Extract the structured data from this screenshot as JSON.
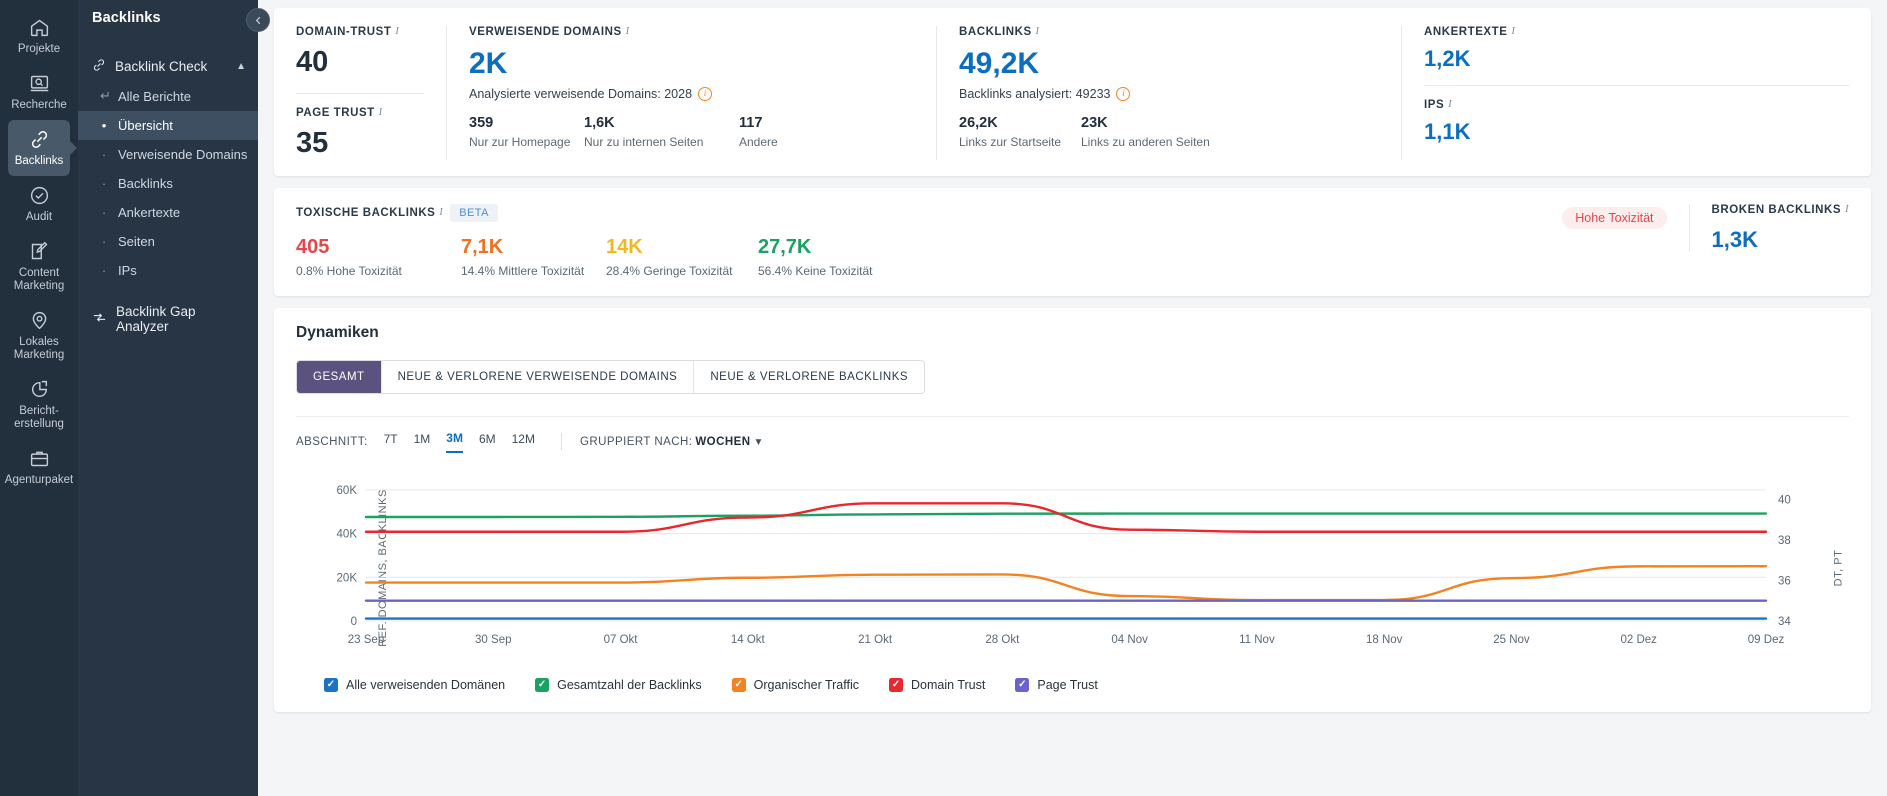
{
  "rail": {
    "items": [
      {
        "label": "Projekte",
        "icon": "home-icon",
        "active": false
      },
      {
        "label": "Recherche",
        "icon": "research-icon",
        "active": false
      },
      {
        "label": "Backlinks",
        "icon": "link-icon",
        "active": true
      },
      {
        "label": "Audit",
        "icon": "check-circle-icon",
        "active": false
      },
      {
        "label": "Content\nMarketing",
        "icon": "edit-square-icon",
        "active": false
      },
      {
        "label": "Lokales\nMarketing",
        "icon": "map-pin-icon",
        "active": false
      },
      {
        "label": "Bericht-\nerstellung",
        "icon": "pie-chart-icon",
        "active": false
      },
      {
        "label": "Agenturpaket",
        "icon": "briefcase-icon",
        "active": false
      }
    ]
  },
  "subnav": {
    "title": "Backlinks",
    "group_label": "Backlink Check",
    "items": [
      {
        "label": "Alle Berichte",
        "marker": "arrow"
      },
      {
        "label": "Übersicht",
        "marker": "dot",
        "selected": true
      },
      {
        "label": "Verweisende Domains",
        "marker": "dash"
      },
      {
        "label": "Backlinks",
        "marker": "dash"
      },
      {
        "label": "Ankertexte",
        "marker": "dash"
      },
      {
        "label": "Seiten",
        "marker": "dash"
      },
      {
        "label": "IPs",
        "marker": "dash"
      }
    ],
    "gap_analyzer": "Backlink Gap Analyzer"
  },
  "kpi": {
    "domain_trust": {
      "label": "DOMAIN-TRUST",
      "value": "40"
    },
    "page_trust": {
      "label": "PAGE TRUST",
      "value": "35"
    },
    "referring_domains": {
      "label": "VERWEISENDE DOMAINS",
      "value": "2K",
      "sub": "Analysierte verweisende Domains: 2028",
      "splits": [
        {
          "value": "359",
          "text": "Nur zur Homepage"
        },
        {
          "value": "1,6K",
          "text": "Nur zu internen Seiten"
        },
        {
          "value": "117",
          "text": "Andere"
        }
      ]
    },
    "backlinks": {
      "label": "BACKLINKS",
      "value": "49,2K",
      "sub": "Backlinks analysiert: 49233",
      "splits": [
        {
          "value": "26,2K",
          "text": "Links zur Startseite"
        },
        {
          "value": "23K",
          "text": "Links zu anderen Seiten"
        }
      ]
    },
    "anchor_texts": {
      "label": "ANKERTEXTE",
      "value": "1,2K"
    },
    "ips": {
      "label": "IPS",
      "value": "1,1K"
    }
  },
  "toxic": {
    "label": "TOXISCHE BACKLINKS",
    "badge": "BETA",
    "items": [
      {
        "value": "405",
        "text": "0.8% Hohe Toxizität",
        "color": "#e8464a"
      },
      {
        "value": "7,1K",
        "text": "14.4% Mittlere Toxizität",
        "color": "#f27021"
      },
      {
        "value": "14K",
        "text": "28.4% Geringe Toxizität",
        "color": "#f0b823"
      },
      {
        "value": "27,7K",
        "text": "56.4% Keine Toxizität",
        "color": "#1aa260"
      }
    ],
    "pill": "Hohe Toxizität",
    "broken": {
      "label": "BROKEN BACKLINKS",
      "value": "1,3K"
    }
  },
  "dynamics": {
    "title": "Dynamiken",
    "tabs": [
      {
        "label": "GESAMT",
        "active": true
      },
      {
        "label": "NEUE & VERLORENE VERWEISENDE DOMAINS",
        "active": false
      },
      {
        "label": "NEUE & VERLORENE BACKLINKS",
        "active": false
      }
    ],
    "period_label": "ABSCHNITT:",
    "periods": [
      {
        "label": "7T",
        "active": false
      },
      {
        "label": "1M",
        "active": false
      },
      {
        "label": "3M",
        "active": true
      },
      {
        "label": "6M",
        "active": false
      },
      {
        "label": "12M",
        "active": false
      }
    ],
    "grouped_label": "GRUPPIERT NACH:",
    "grouped_value": "WOCHEN"
  },
  "chart_data": {
    "type": "line",
    "title": "Dynamiken",
    "ylabel": "REF. DOMAINS, BACKLINKS",
    "ylabel_right": "DT, PT",
    "grid": true,
    "legend_position": "bottom",
    "ylim": [
      0,
      65000
    ],
    "yticks": [
      "0",
      "20K",
      "40K",
      "60K"
    ],
    "ytick_values": [
      0,
      20000,
      40000,
      60000
    ],
    "ylim_right": [
      34,
      41
    ],
    "yticks_right": [
      "34",
      "36",
      "38",
      "40"
    ],
    "ytick_values_right": [
      34,
      36,
      38,
      40
    ],
    "x": [
      "23 Sep",
      "30 Sep",
      "07 Okt",
      "14 Okt",
      "21 Okt",
      "28 Okt",
      "04 Nov",
      "11 Nov",
      "18 Nov",
      "25 Nov",
      "02 Dez",
      "09 Dez"
    ],
    "series": [
      {
        "name": "Alle verweisenden Domänen",
        "color": "#1a73c4",
        "axis": "left",
        "values": [
          1100,
          1100,
          1100,
          1100,
          1100,
          1100,
          1100,
          1100,
          1100,
          1100,
          1100,
          1100
        ]
      },
      {
        "name": "Gesamtzahl der Backlinks",
        "color": "#1aa260",
        "axis": "left",
        "values": [
          47600,
          47600,
          47700,
          48200,
          48800,
          49100,
          49200,
          49200,
          49200,
          49200,
          49200,
          49200
        ]
      },
      {
        "name": "Organischer Traffic",
        "color": "#f58220",
        "axis": "left",
        "values": [
          17600,
          17600,
          17600,
          19800,
          21200,
          21300,
          11400,
          9600,
          9600,
          19600,
          25000,
          25100
        ]
      },
      {
        "name": "Domain Trust",
        "color": "#e8282d",
        "axis": "right",
        "values": [
          38.4,
          38.4,
          38.4,
          39.1,
          39.8,
          39.8,
          38.5,
          38.4,
          38.4,
          38.4,
          38.4,
          38.4
        ]
      },
      {
        "name": "Page Trust",
        "color": "#6b63c9",
        "axis": "left",
        "values": [
          9300,
          9300,
          9300,
          9300,
          9300,
          9300,
          9300,
          9300,
          9300,
          9300,
          9300,
          9300
        ]
      }
    ],
    "legend": [
      {
        "label": "Alle verweisenden Domänen",
        "color": "#1a73c4"
      },
      {
        "label": "Gesamtzahl der Backlinks",
        "color": "#1aa260"
      },
      {
        "label": "Organischer Traffic",
        "color": "#f58220"
      },
      {
        "label": "Domain Trust",
        "color": "#e8282d"
      },
      {
        "label": "Page Trust",
        "color": "#6b63c9"
      }
    ]
  }
}
